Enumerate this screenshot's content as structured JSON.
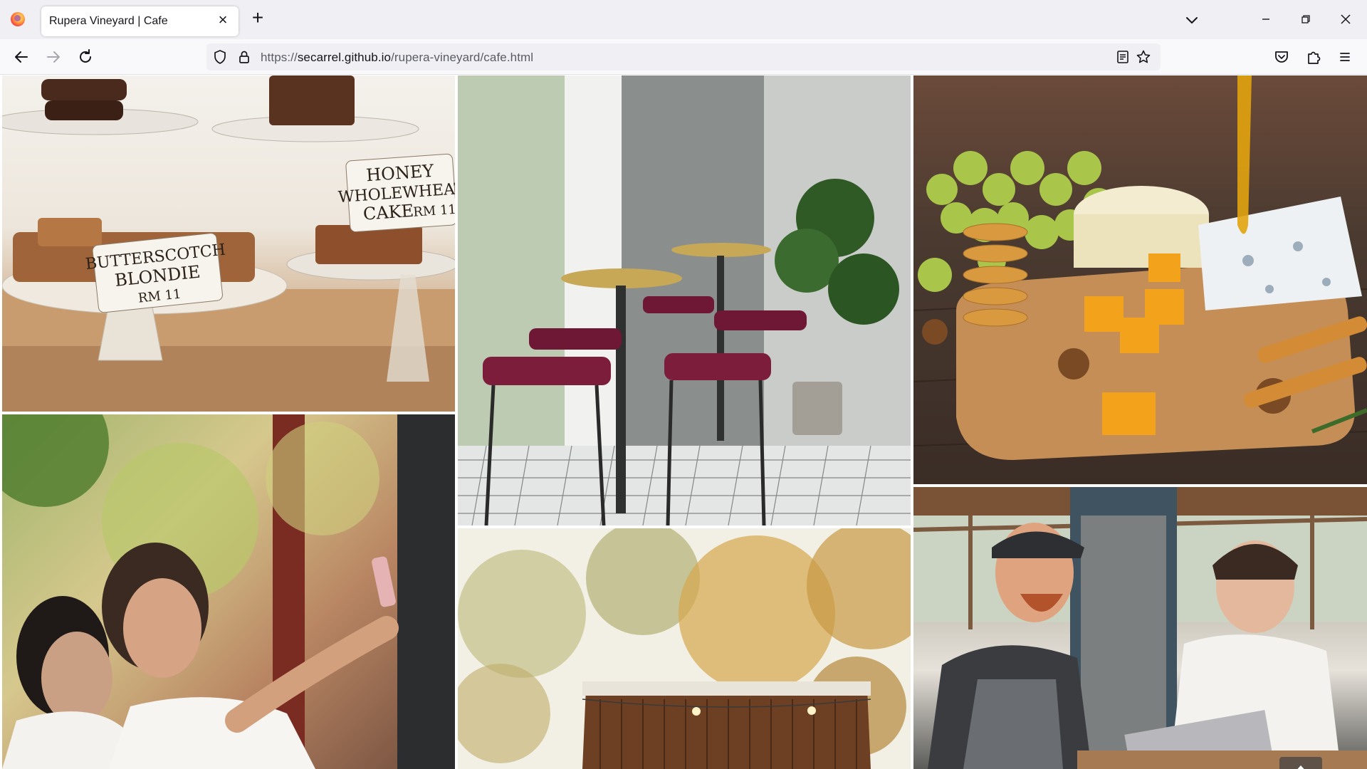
{
  "browser": {
    "tab_title": "Rupera Vineyard | Cafe",
    "url_prefix": "https://",
    "url_host": "secarrel.github.io",
    "url_path": "/rupera-vineyard/cafe.html"
  },
  "icons": {
    "back": "arrow-left-icon",
    "forward": "arrow-right-icon",
    "reload": "reload-icon",
    "shield": "shield-icon",
    "lock": "lock-icon",
    "reader": "reader-view-icon",
    "bookmark": "star-icon",
    "pocket": "pocket-icon",
    "extensions": "puzzle-icon",
    "menu": "hamburger-menu-icon",
    "scroll_top": "arrow-up-icon"
  },
  "gallery": {
    "tiles": [
      {
        "subject": "Cakes on stands with labels"
      },
      {
        "subject": "Cafe interior with bar stools and tables"
      },
      {
        "subject": "Cheese board with grapes and honey"
      },
      {
        "subject": "Two women taking a selfie"
      },
      {
        "subject": "Outdoor garden with string lights"
      },
      {
        "subject": "Baristas working at a laptop"
      }
    ],
    "labels": {
      "cake1_line1": "HONEY",
      "cake1_line2": "WHOLEWHEAT",
      "cake1_line3": "CAKE",
      "cake1_price": "RM 11",
      "cake2_line1": "BUTTERSCOTCH",
      "cake2_line2": "BLONDIE",
      "cake2_price": "RM 11"
    }
  }
}
